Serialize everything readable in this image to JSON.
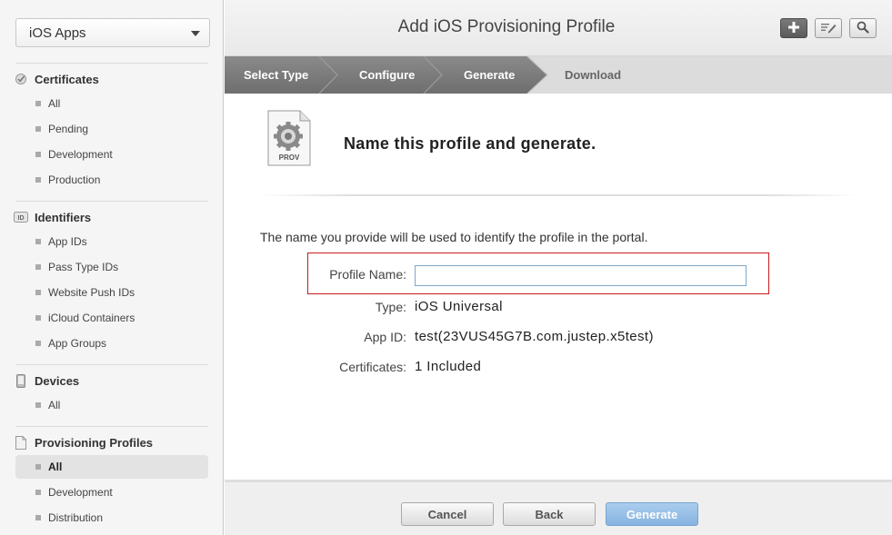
{
  "sidebar": {
    "app_select": "iOS Apps",
    "sections": {
      "certificates": {
        "title": "Certificates",
        "items": [
          "All",
          "Pending",
          "Development",
          "Production"
        ]
      },
      "identifiers": {
        "title": "Identifiers",
        "items": [
          "App IDs",
          "Pass Type IDs",
          "Website Push IDs",
          "iCloud Containers",
          "App Groups"
        ]
      },
      "devices": {
        "title": "Devices",
        "items": [
          "All"
        ]
      },
      "provisioning": {
        "title": "Provisioning Profiles",
        "items": [
          "All",
          "Development",
          "Distribution"
        ],
        "active_item": "All"
      }
    },
    "identifiers_badge": "ID"
  },
  "header": {
    "title": "Add iOS Provisioning Profile",
    "tools": [
      "add-icon",
      "edit-icon",
      "search-icon"
    ]
  },
  "steps": {
    "items": [
      "Select Type",
      "Configure",
      "Generate",
      "Download"
    ],
    "current": "Generate"
  },
  "content": {
    "icon_label": "PROV",
    "heading": "Name this profile and generate.",
    "description": "The name you provide will be used to identify the profile in the portal.",
    "fields": {
      "profile_name_label": "Profile Name:",
      "profile_name_value": "",
      "type_label": "Type:",
      "type_value": "iOS Universal",
      "app_id_label": "App ID:",
      "app_id_value": "test(23VUS45G7B.com.justep.x5test)",
      "certificates_label": "Certificates:",
      "certificates_value": "1 Included"
    }
  },
  "footer": {
    "cancel": "Cancel",
    "back": "Back",
    "generate": "Generate"
  },
  "colors": {
    "highlight_box": "#cc1b1b",
    "primary_button": "#86b3e0",
    "steps_active": "#6e6e6e"
  }
}
